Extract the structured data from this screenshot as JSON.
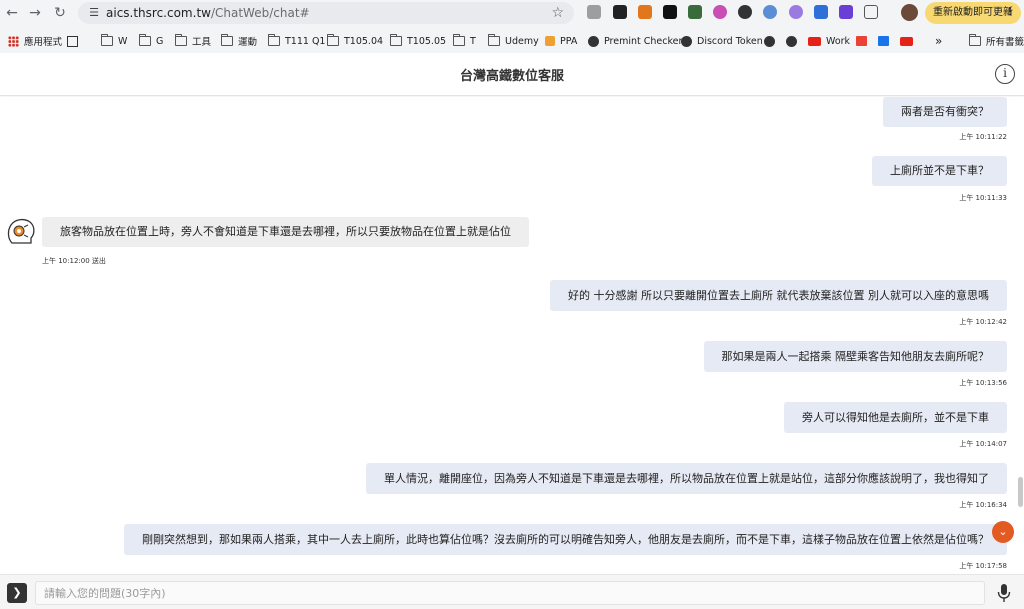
{
  "browser": {
    "url_host": "aics.thsrc.com.tw",
    "url_path": "/ChatWeb/chat#",
    "update_button": "重新啟動即可更新",
    "bookmarks": [
      {
        "label": "應用程式",
        "icon": "apps-icon"
      },
      {
        "label": "",
        "icon": "grid-icon"
      },
      {
        "label": "W",
        "icon": "folder-icon"
      },
      {
        "label": "G",
        "icon": "folder-icon"
      },
      {
        "label": "工具",
        "icon": "folder-icon"
      },
      {
        "label": "運動",
        "icon": "folder-icon"
      },
      {
        "label": "T111 Q1",
        "icon": "folder-icon"
      },
      {
        "label": "T105.04",
        "icon": "folder-icon"
      },
      {
        "label": "T105.05",
        "icon": "folder-icon"
      },
      {
        "label": "T",
        "icon": "folder-icon"
      },
      {
        "label": "Udemy",
        "icon": "folder-icon"
      },
      {
        "label": "PPA",
        "icon": "ppa-icon"
      },
      {
        "label": "Premint Checker",
        "icon": "globe-icon"
      },
      {
        "label": "Discord Token",
        "icon": "globe-icon"
      },
      {
        "label": "Work",
        "icon": "youtube-icon"
      },
      {
        "label": "所有書籤",
        "icon": "folder-icon"
      }
    ]
  },
  "app": {
    "title": "台灣高鐵數位客服",
    "info_icon": "info-icon"
  },
  "messages": [
    {
      "sender": "user",
      "text": "兩者是否有衝突？",
      "time": "上午 10:11:22"
    },
    {
      "sender": "user",
      "text": "上廁所並不是下車？",
      "time": "上午 10:11:33"
    },
    {
      "sender": "bot",
      "text": "旅客物品放在位置上時，旁人不會知道是下車還是去哪裡，所以只要放物品在位置上就是佔位",
      "time": "上午 10:12:00 送出"
    },
    {
      "sender": "user",
      "text": "好的 十分感謝 所以只要離開位置去上廁所 就代表放棄該位置 別人就可以入座的意思嗎",
      "time": "上午 10:12:42"
    },
    {
      "sender": "user",
      "text": "那如果是兩人一起搭乘 隔壁乘客告知他朋友去廁所呢？",
      "time": "上午 10:13:56"
    },
    {
      "sender": "user",
      "text": "旁人可以得知他是去廁所，並不是下車",
      "time": "上午 10:14:07"
    },
    {
      "sender": "user",
      "text": "單人情況，離開座位，因為旁人不知道是下車還是去哪裡，所以物品放在位置上就是站位，這部分你應該說明了，我也得知了",
      "time": "上午 10:16:34"
    },
    {
      "sender": "user",
      "text": "剛剛突然想到，那如果兩人搭乘，其中一人去上廁所，此時也算佔位嗎？沒去廁所的可以明確告知旁人，他朋友是去廁所，而不是下車，這樣子物品放在位置上依然是佔位嗎？",
      "time": "上午 10:17:58"
    }
  ],
  "input": {
    "placeholder": "請輸入您的問題(30字內)"
  },
  "colors": {
    "user_bubble": "#e6eaf4",
    "bot_bubble": "#eeeeee",
    "accent": "#e35a22",
    "update_button": "#f7d873"
  }
}
